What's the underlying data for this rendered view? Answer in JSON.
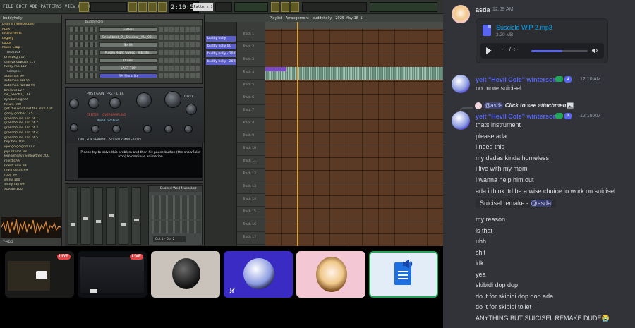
{
  "daw": {
    "menu_text": "FILE EDIT ADD PATTERNS VIEW OPTIONS TOOLS HELP",
    "clock": "2:10:58",
    "pattern_label": "Pattern 1",
    "browser": {
      "header": "buddyholly",
      "folders": [
        "Drums (Weekdublo)",
        "FLEX",
        "Instruments",
        "Legacy",
        "Loops",
        "Music Crap"
      ],
      "subfolders": [
        "Beatbox",
        "Samples"
      ],
      "items": [
        "brenbkg 117",
        "crimyx cowbss 117",
        "funky rap 117"
      ],
      "samples": [
        "automan 99",
        "automan bzz 99",
        "automan fall 80 99",
        "bmrand 127",
        "cw_peech1_173",
        "cyndarn kg 99",
        "future 100",
        "get the what out the club 100",
        "goofy goober 145",
        "greenhouse 140 pt 1",
        "greenhouse 140 pt 2",
        "greenhouse 140 pt 3",
        "greenhouse 140 pt 4",
        "greenhouse 140 pt 5",
        "hey hey 100",
        "igorigoigoigod 117",
        "juju drums 99",
        "lemonheavy yellowtree 200",
        "mordis 99",
        "noeth now 99",
        "real noeths 99",
        "ruby 99",
        "shiny 100",
        "shiny rap 99",
        "Suicite 100"
      ],
      "footer": "7-ADD"
    },
    "rack": {
      "title": "buddyholly",
      "channels": [
        "Gatlers",
        "Sneakbeat_O__Shadow__MA_02...",
        "Serith",
        "Pulseg Right Sweep_ Vibrato...",
        "Drums",
        "LAST TOP",
        "RM Plural Bx"
      ]
    },
    "plugin": {
      "labels": [
        "POST GAIN",
        "PRE FILTER",
        "DIRTY",
        "CENTER",
        "OVERSAMPLING",
        "Mixed combine"
      ],
      "bottom_labels": [
        "LIMIT SLIP SHAPPLY",
        "SOUND RUMBLER-DRV"
      ],
      "message": "Please try to solve this problem and then hit pause button (the snowflake icon) to continue animation"
    },
    "fx": {
      "title": "Buzzed-Wed Musasket",
      "selector": "Out 1 - Out 2"
    },
    "playlist": {
      "title": "Playlist - Arrangement - buddyholly - 2025 May 18_1",
      "patterns": [
        "buddy holly",
        "buddy holly 0C",
        "buddy holly - 2025",
        "buddy holly - 2025"
      ],
      "tracks": [
        "Track 1",
        "Track 2",
        "Track 3",
        "Track 4",
        "Track 5",
        "Track 6",
        "Track 7",
        "Track 8",
        "Track 9",
        "Track 10",
        "Track 11",
        "Track 12",
        "Track 13",
        "Track 14",
        "Track 15",
        "Track 16",
        "Track 17"
      ]
    }
  },
  "thumbnails": [
    {
      "name": "stream-1",
      "live": "LIVE"
    },
    {
      "name": "stream-2",
      "live": "LIVE"
    },
    {
      "name": "avatar-tile-1"
    },
    {
      "name": "avatar-tile-2"
    },
    {
      "name": "avatar-tile-3"
    },
    {
      "name": "attachment-tile"
    }
  ],
  "chat": {
    "messages": [
      {
        "author": "asda",
        "time": "12:09 AM",
        "attachment": {
          "filename": "Suscicle WiP 2.mp3",
          "size": "2.20 MB",
          "time": "-:-- / -:--",
          "progress": 0.55
        }
      },
      {
        "author": "yeit \"Hevil Cole\" winterson",
        "badge": "u",
        "time": "12:10 AM",
        "lines": [
          "no more suicisel"
        ]
      },
      {
        "reply_to": "@asda",
        "reply_text": "Click to see attachment",
        "author": "yeit \"Hevil Cole\" winterson",
        "badge": "u",
        "time": "12:10 AM",
        "lines": [
          "thats instrument",
          "please ada",
          "i need this",
          "my dadas kinda homeless",
          "i live with my mom",
          "i wanna help him out",
          "ada i think itd be a wise choice to work on suicisel"
        ],
        "embed": {
          "text": "Suicisel remake - ",
          "mention": "@asda"
        },
        "lines2": [
          "my reason",
          "is that",
          "uhh",
          "shit",
          "idk",
          "yea",
          "skibidi dop dop",
          "do it for skibidi dop dop ada",
          "do it for skibidi toilet",
          "ANYTHING BUT SUICISEL REMAKE DUDE😭"
        ]
      }
    ]
  },
  "colors": {
    "chat_bg": "#313338",
    "link": "#00a8fc",
    "author_asda": "#dbdee1",
    "author_yeit": "#5865f2",
    "live": "#ed4245"
  }
}
